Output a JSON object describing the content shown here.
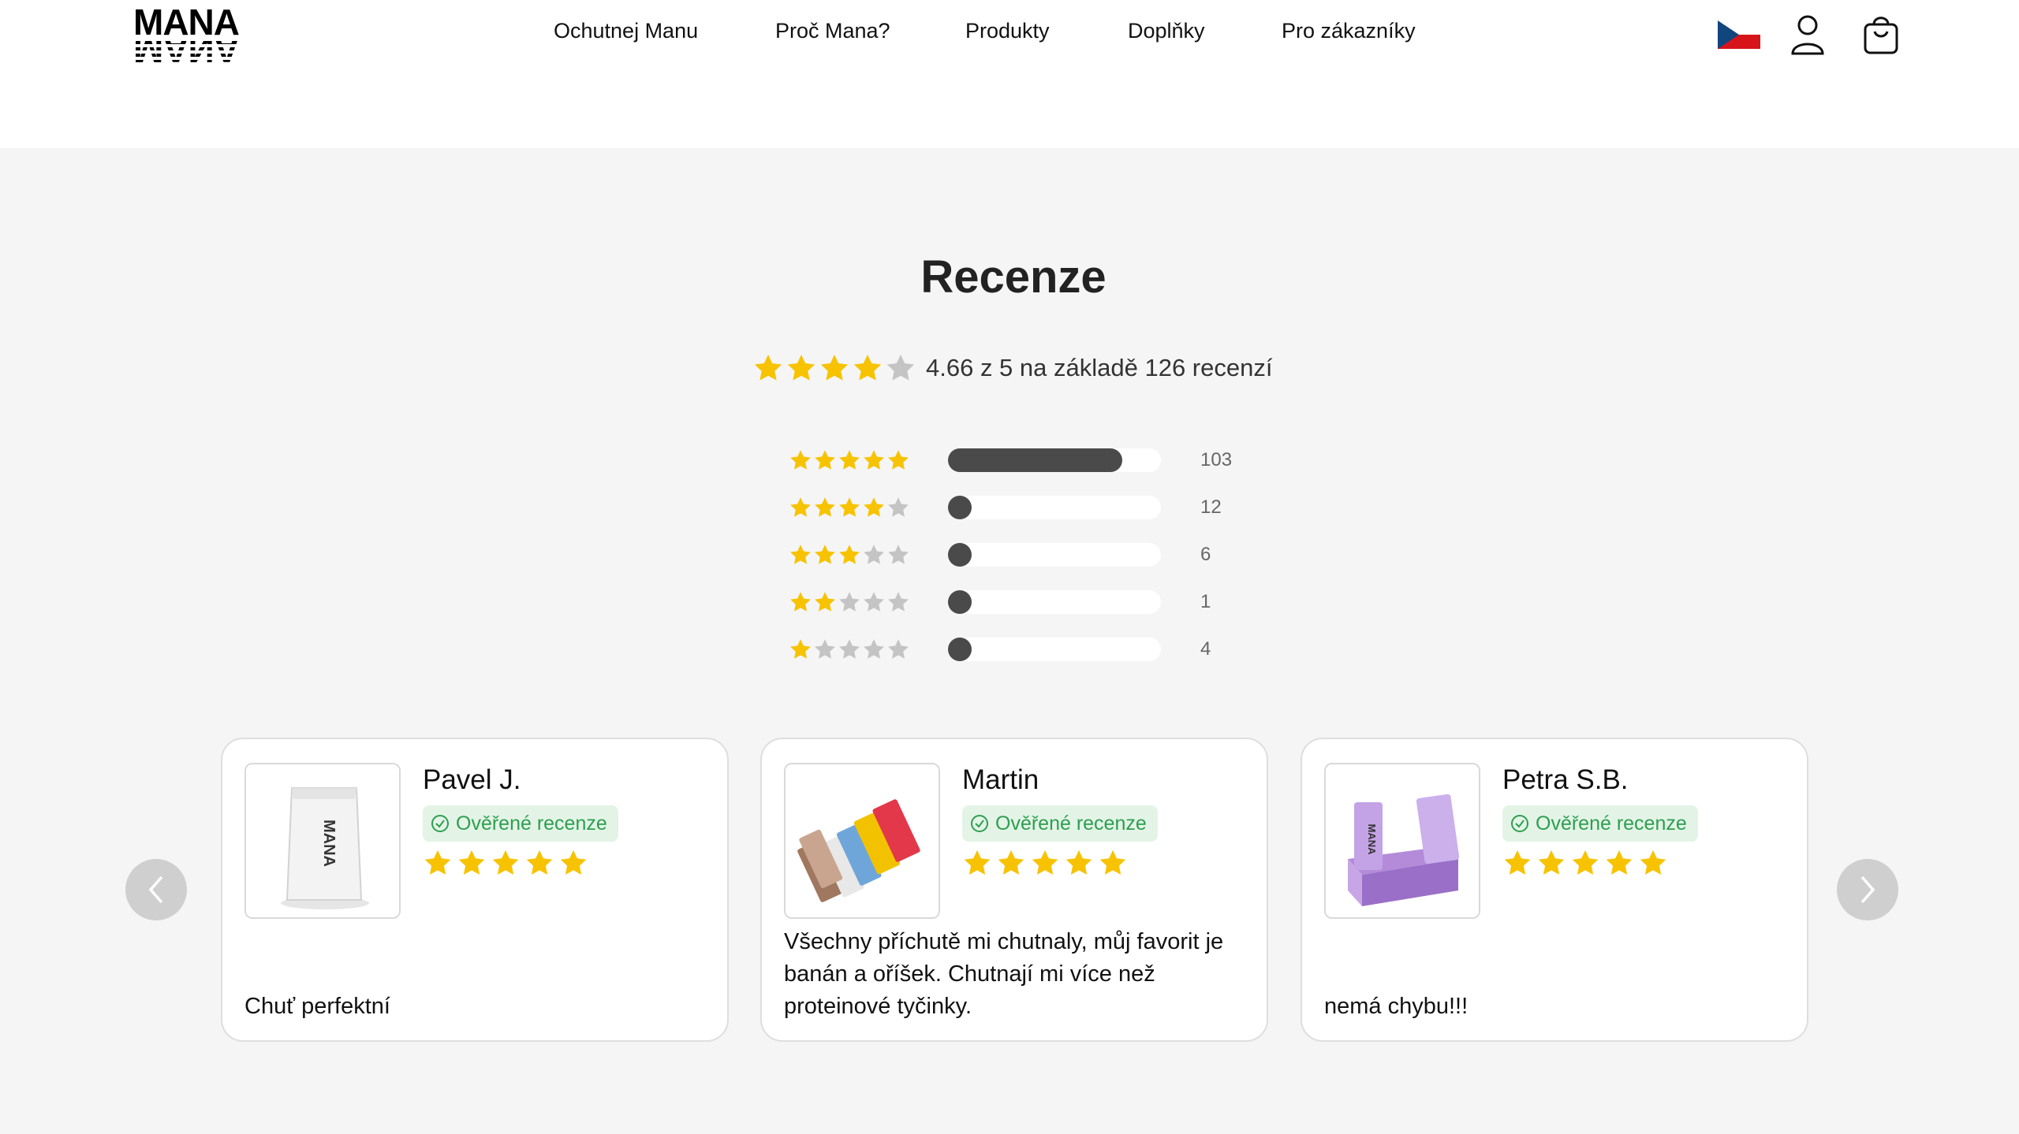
{
  "header": {
    "logo_text": "MANA",
    "nav": [
      "Ochutnej Manu",
      "Proč Mana?",
      "Produkty",
      "Doplňky",
      "Pro zákazníky"
    ]
  },
  "reviews": {
    "title": "Recenze",
    "average": 4.66,
    "summary_text": "4.66 z 5 na základě 126 recenzí",
    "distribution": [
      {
        "stars": 5,
        "count": "103",
        "fraction": 0.82
      },
      {
        "stars": 4,
        "count": "12",
        "fraction": 0.1
      },
      {
        "stars": 3,
        "count": "6",
        "fraction": 0.05
      },
      {
        "stars": 2,
        "count": "1",
        "fraction": 0.01
      },
      {
        "stars": 1,
        "count": "4",
        "fraction": 0.03
      }
    ],
    "cards": [
      {
        "name": "Pavel J.",
        "badge": "Ověřené recenze",
        "rating": 5,
        "text": "Chuť perfektní",
        "image": "mana-powder-bag"
      },
      {
        "name": "Martin",
        "badge": "Ověřené recenze",
        "rating": 5,
        "text": "Všechny příchutě mi chutnaly, můj favorit je banán a oříšek. Chutnají mi více než proteinové tyčinky.",
        "image": "mana-bars-assortment"
      },
      {
        "name": "Petra S.B.",
        "badge": "Ověřené recenze",
        "rating": 5,
        "text": "nemá chybu!!!",
        "image": "mana-bars-box"
      }
    ]
  },
  "colors": {
    "star": "#f7c300",
    "star_empty": "#c4c4c4",
    "bar": "#4a4a4a",
    "badge_bg": "#e3f4e7",
    "badge_text": "#2e9e4f",
    "section_bg": "#f5f5f5"
  },
  "icons": [
    "czech-flag-icon",
    "user-icon",
    "shopping-bag-icon",
    "chevron-left-icon",
    "chevron-right-icon",
    "check-circle-icon",
    "star-icon"
  ]
}
